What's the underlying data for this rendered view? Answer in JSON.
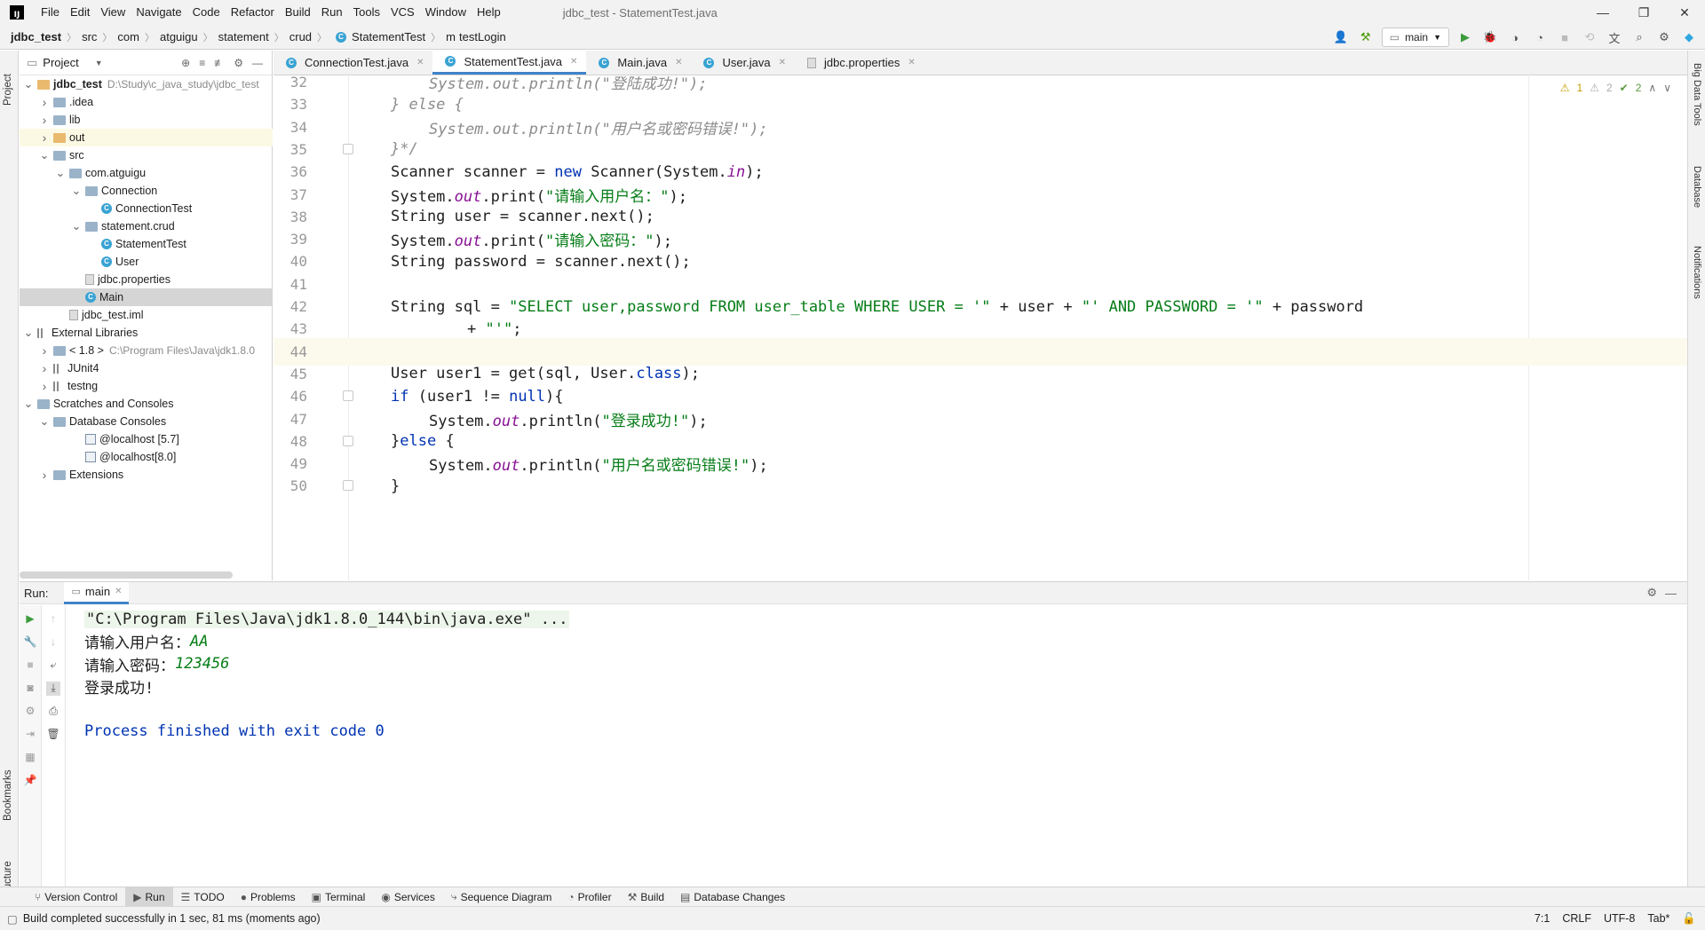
{
  "window": {
    "title": "jdbc_test - StatementTest.java",
    "menu": [
      "File",
      "Edit",
      "View",
      "Navigate",
      "Code",
      "Refactor",
      "Build",
      "Run",
      "Tools",
      "VCS",
      "Window",
      "Help"
    ],
    "controls": [
      "—",
      "❐",
      "✕"
    ]
  },
  "breadcrumb": [
    "jdbc_test",
    "src",
    "com",
    "atguigu",
    "statement",
    "crud",
    "StatementTest",
    "testLogin"
  ],
  "toolbar": {
    "run_config": "main"
  },
  "left_stripe": {
    "project": "Project",
    "bookmarks": "Bookmarks",
    "structure": "Structure"
  },
  "right_stripe": {
    "big_data": "Big Data Tools",
    "database": "Database",
    "notifications": "Notifications"
  },
  "project_panel": {
    "title": "Project",
    "tree": [
      {
        "label": "jdbc_test",
        "detail": "D:\\Study\\c_java_study\\jdbc_test",
        "level": 0,
        "arrow": "v",
        "icon": "folder-y",
        "bold": true
      },
      {
        "label": ".idea",
        "level": 1,
        "arrow": ">",
        "icon": "folder"
      },
      {
        "label": "lib",
        "level": 1,
        "arrow": ">",
        "icon": "folder"
      },
      {
        "label": "out",
        "level": 1,
        "arrow": ">",
        "icon": "folder-y",
        "highlight": true
      },
      {
        "label": "src",
        "level": 1,
        "arrow": "v",
        "icon": "folder"
      },
      {
        "label": "com.atguigu",
        "level": 2,
        "arrow": "v",
        "icon": "folder"
      },
      {
        "label": "Connection",
        "level": 3,
        "arrow": "v",
        "icon": "folder"
      },
      {
        "label": "ConnectionTest",
        "level": 4,
        "arrow": "",
        "icon": "class"
      },
      {
        "label": "statement.crud",
        "level": 3,
        "arrow": "v",
        "icon": "folder"
      },
      {
        "label": "StatementTest",
        "level": 4,
        "arrow": "",
        "icon": "class"
      },
      {
        "label": "User",
        "level": 4,
        "arrow": "",
        "icon": "class"
      },
      {
        "label": "jdbc.properties",
        "level": 3,
        "arrow": "",
        "icon": "file"
      },
      {
        "label": "Main",
        "level": 3,
        "arrow": "",
        "icon": "class",
        "selected": true
      },
      {
        "label": "jdbc_test.iml",
        "level": 2,
        "arrow": "",
        "icon": "file"
      },
      {
        "label": "External Libraries",
        "level": 0,
        "arrow": "v",
        "icon": "lib"
      },
      {
        "label": "< 1.8 >",
        "detail": "C:\\Program Files\\Java\\jdk1.8.0",
        "level": 1,
        "arrow": ">",
        "icon": "folder"
      },
      {
        "label": "JUnit4",
        "level": 1,
        "arrow": ">",
        "icon": "lib"
      },
      {
        "label": "testng",
        "level": 1,
        "arrow": ">",
        "icon": "lib"
      },
      {
        "label": "Scratches and Consoles",
        "level": 0,
        "arrow": "v",
        "icon": "folder"
      },
      {
        "label": "Database Consoles",
        "level": 1,
        "arrow": "v",
        "icon": "folder"
      },
      {
        "label": "@localhost [5.7]",
        "level": 3,
        "arrow": "",
        "icon": "db"
      },
      {
        "label": "@localhost[8.0]",
        "level": 3,
        "arrow": "",
        "icon": "db"
      },
      {
        "label": "Extensions",
        "level": 1,
        "arrow": ">",
        "icon": "folder"
      }
    ]
  },
  "editor_tabs": [
    {
      "label": "ConnectionTest.java",
      "active": false
    },
    {
      "label": "StatementTest.java",
      "active": true
    },
    {
      "label": "Main.java",
      "active": false
    },
    {
      "label": "User.java",
      "active": false
    },
    {
      "label": "jdbc.properties",
      "active": false
    }
  ],
  "inspections": {
    "warnings": "1",
    "weak": "2",
    "ok": "2"
  },
  "code_lines": [
    {
      "n": "32",
      "indent": 1,
      "parts": [
        [
          "cmt",
          "System.out.println(\"登陆成功!\");"
        ]
      ]
    },
    {
      "n": "33",
      "indent": 0,
      "parts": [
        [
          "cmt",
          "} else {"
        ]
      ]
    },
    {
      "n": "34",
      "indent": 1,
      "parts": [
        [
          "cmt",
          "System.out.println(\"用户名或密码错误!\");"
        ]
      ]
    },
    {
      "n": "35",
      "indent": 0,
      "parts": [
        [
          "cmt",
          "}*/"
        ]
      ],
      "fold": true
    },
    {
      "n": "36",
      "indent": 0,
      "parts": [
        [
          "",
          "Scanner scanner = "
        ],
        [
          "kw",
          "new"
        ],
        [
          "",
          " Scanner(System."
        ],
        [
          "static",
          "in"
        ],
        [
          "",
          ");"
        ]
      ]
    },
    {
      "n": "37",
      "indent": 0,
      "parts": [
        [
          "",
          "System."
        ],
        [
          "static",
          "out"
        ],
        [
          "",
          ".print("
        ],
        [
          "str",
          "\"请输入用户名：\""
        ],
        [
          "",
          ");"
        ]
      ]
    },
    {
      "n": "38",
      "indent": 0,
      "parts": [
        [
          "",
          "String user = scanner.next();"
        ]
      ]
    },
    {
      "n": "39",
      "indent": 0,
      "parts": [
        [
          "",
          "System."
        ],
        [
          "static",
          "out"
        ],
        [
          "",
          ".print("
        ],
        [
          "str",
          "\"请输入密码：\""
        ],
        [
          "",
          ");"
        ]
      ]
    },
    {
      "n": "40",
      "indent": 0,
      "parts": [
        [
          "",
          "String password = scanner.next();"
        ]
      ]
    },
    {
      "n": "41",
      "indent": 0,
      "parts": []
    },
    {
      "n": "42",
      "indent": 0,
      "parts": [
        [
          "",
          "String sql = "
        ],
        [
          "str",
          "\"SELECT user,password FROM user_table WHERE USER = '\""
        ],
        [
          "",
          " + user + "
        ],
        [
          "str",
          "\"' AND PASSWORD = '\""
        ],
        [
          "",
          " + password"
        ]
      ]
    },
    {
      "n": "43",
      "indent": 2,
      "parts": [
        [
          "",
          "+ "
        ],
        [
          "str",
          "\"'\""
        ],
        [
          "",
          ";"
        ]
      ]
    },
    {
      "n": "44",
      "indent": 0,
      "parts": [],
      "current": true
    },
    {
      "n": "45",
      "indent": 0,
      "parts": [
        [
          "",
          "User user1 = get(sql, User."
        ],
        [
          "kw",
          "class"
        ],
        [
          "",
          ");"
        ]
      ]
    },
    {
      "n": "46",
      "indent": 0,
      "parts": [
        [
          "kw",
          "if"
        ],
        [
          "",
          " (user1 != "
        ],
        [
          "kw",
          "null"
        ],
        [
          "",
          "){"
        ]
      ],
      "fold": true
    },
    {
      "n": "47",
      "indent": 1,
      "parts": [
        [
          "",
          "System."
        ],
        [
          "static",
          "out"
        ],
        [
          "",
          ".println("
        ],
        [
          "str",
          "\"登录成功!\""
        ],
        [
          "",
          ");"
        ]
      ]
    },
    {
      "n": "48",
      "indent": 0,
      "parts": [
        [
          "",
          "}"
        ],
        [
          "kw",
          "else"
        ],
        [
          "",
          " {"
        ]
      ],
      "fold": true
    },
    {
      "n": "49",
      "indent": 1,
      "parts": [
        [
          "",
          "System."
        ],
        [
          "static",
          "out"
        ],
        [
          "",
          ".println("
        ],
        [
          "str",
          "\"用户名或密码错误!\""
        ],
        [
          "",
          ");"
        ]
      ]
    },
    {
      "n": "50",
      "indent": 0,
      "parts": [
        [
          "",
          "}"
        ]
      ],
      "fold": true
    }
  ],
  "run_panel": {
    "label": "Run:",
    "tab": "main",
    "console": [
      {
        "type": "cmd",
        "text": "\"C:\\Program Files\\Java\\jdk1.8.0_144\\bin\\java.exe\" ..."
      },
      {
        "type": "prompt",
        "text": "请输入用户名：",
        "input": "AA"
      },
      {
        "type": "prompt",
        "text": "请输入密码：",
        "input": "123456"
      },
      {
        "type": "out",
        "text": "登录成功!"
      },
      {
        "type": "blank",
        "text": ""
      },
      {
        "type": "proc",
        "text": "Process finished with exit code 0"
      }
    ]
  },
  "tool_windows": [
    {
      "label": "Version Control",
      "icon": "⑂"
    },
    {
      "label": "Run",
      "icon": "▶",
      "active": true
    },
    {
      "label": "TODO",
      "icon": "☰"
    },
    {
      "label": "Problems",
      "icon": "●"
    },
    {
      "label": "Terminal",
      "icon": "▣"
    },
    {
      "label": "Services",
      "icon": "◉"
    },
    {
      "label": "Sequence Diagram",
      "icon": "⤷"
    },
    {
      "label": "Profiler",
      "icon": "◔"
    },
    {
      "label": "Build",
      "icon": "⚒"
    },
    {
      "label": "Database Changes",
      "icon": "▤"
    }
  ],
  "status": {
    "message": "Build completed successfully in 1 sec, 81 ms (moments ago)",
    "position": "7:1",
    "line_sep": "CRLF",
    "encoding": "UTF-8",
    "indent": "Tab*"
  }
}
